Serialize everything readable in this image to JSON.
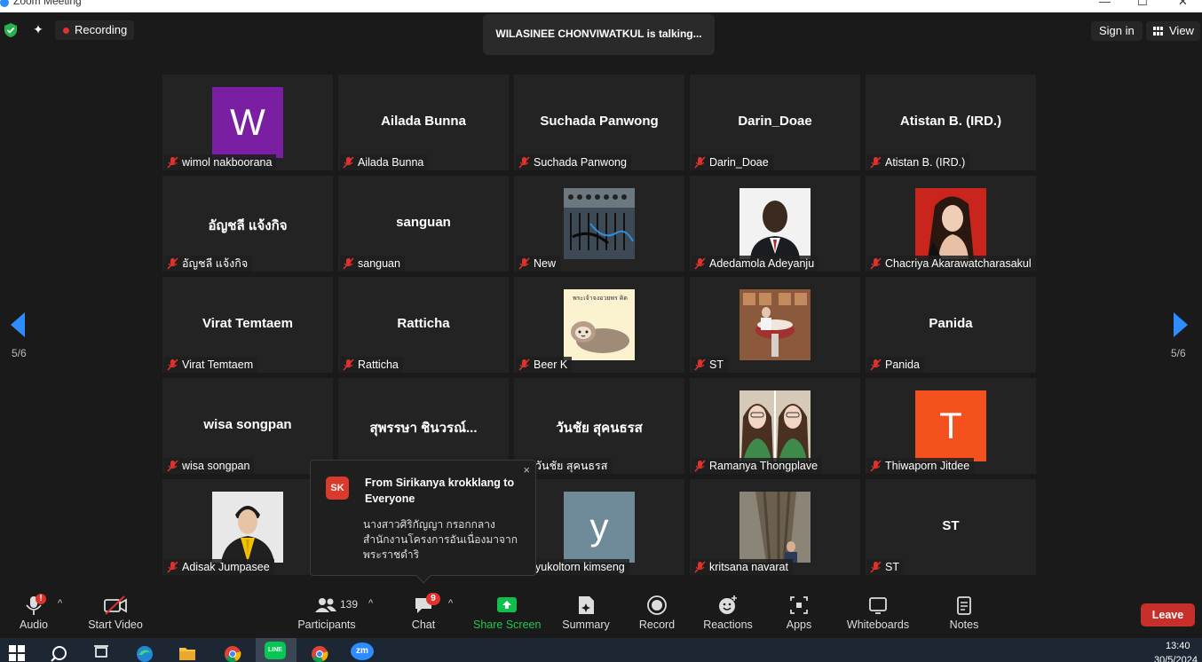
{
  "window": {
    "title": "Zoom Meeting",
    "controls": [
      "—",
      "☐",
      "✕"
    ]
  },
  "topbar": {
    "recording_label": "Recording",
    "talking_text": "WILASINEE CHONVIWATKUL is talking...",
    "sign_in": "Sign in",
    "view": "View"
  },
  "pagination": {
    "left": "5/6",
    "right": "5/6"
  },
  "participants_grid": [
    {
      "name": "wimol nakboorana",
      "display": "",
      "avatar": "letter",
      "letter": "W",
      "color": "#7b1fa2"
    },
    {
      "name": "Ailada Bunna",
      "display": "Ailada Bunna"
    },
    {
      "name": "Suchada Panwong",
      "display": "Suchada Panwong"
    },
    {
      "name": "Darin_Doae",
      "display": "Darin_Doae"
    },
    {
      "name": "Atistan B. (IRD.)",
      "display": "Atistan B. (IRD.)"
    },
    {
      "name": "อัญชลี แจ้งกิจ",
      "display": "อัญชลี แจ้งกิจ"
    },
    {
      "name": "sanguan",
      "display": "sanguan"
    },
    {
      "name": "New",
      "display": "",
      "avatar": "mixer-photo"
    },
    {
      "name": "Adedamola Adeyanju",
      "display": "",
      "avatar": "portrait-photo"
    },
    {
      "name": "Chacriya Akarawatcharasakul",
      "display": "",
      "avatar": "woman-photo"
    },
    {
      "name": "Virat Temtaem",
      "display": "Virat Temtaem"
    },
    {
      "name": "Ratticha",
      "display": "Ratticha"
    },
    {
      "name": "Beer K",
      "display": "",
      "avatar": "sloth-sticker",
      "sticker_text": "พระเจ้าจงอวยพร คิด"
    },
    {
      "name": "ST",
      "display": "",
      "avatar": "room-photo"
    },
    {
      "name": "Panida",
      "display": "Panida"
    },
    {
      "name": "wisa songpan",
      "display": "wisa songpan"
    },
    {
      "name": "สุพรรษา ชินวรณ์...",
      "display": "สุพรรษา ชินวรณ์..."
    },
    {
      "name": "วันชัย สุคนธรส",
      "display": "วันชัย สุคนธรส"
    },
    {
      "name": "Ramanya Thongplave",
      "display": "",
      "avatar": "selfie-photo"
    },
    {
      "name": "Thiwaporn Jitdee",
      "display": "",
      "avatar": "letter",
      "letter": "T",
      "color": "#f4511e"
    },
    {
      "name": "Adisak Jumpasee",
      "display": "",
      "avatar": "suit-photo"
    },
    {
      "name": "",
      "display": ""
    },
    {
      "name": "yukoltorn kimseng",
      "display": "",
      "avatar": "letter",
      "letter": "y",
      "color": "#6f8a99"
    },
    {
      "name": "kritsana navarat",
      "display": "",
      "avatar": "tree-photo"
    },
    {
      "name": "ST",
      "display": "ST"
    }
  ],
  "chat_popup": {
    "initials": "SK",
    "from": "From Sirikanya krokklang to Everyone",
    "message": "นางสาวศิริกัญญา กรอกกลาง สำนักงานโครงการอันเนื่องมาจากพระราชดำริ",
    "close": "×",
    "hidden_label": "วันชัย สุคนธรส"
  },
  "toolbar": {
    "audio": "Audio",
    "audio_badge": "!",
    "start_video": "Start Video",
    "participants": "Participants",
    "participants_count": "139",
    "chat": "Chat",
    "chat_badge": "9",
    "share_screen": "Share Screen",
    "summary": "Summary",
    "record": "Record",
    "reactions": "Reactions",
    "apps": "Apps",
    "whiteboards": "Whiteboards",
    "notes": "Notes",
    "leave": "Leave",
    "caret": "^"
  },
  "taskbar": {
    "time": "13:40",
    "date": "30/5/2024",
    "zoom_label": "zm",
    "line_label": "LINE"
  },
  "colors": {
    "background": "#1a1a1a",
    "tile": "#232323",
    "share_green": "#0fbf4a",
    "leave_red": "#c7302a",
    "accent_blue": "#2d8cff"
  }
}
